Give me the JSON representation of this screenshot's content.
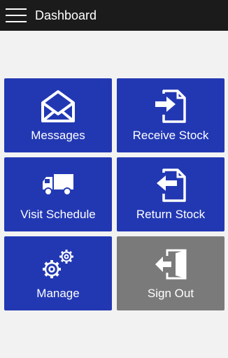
{
  "appbar": {
    "title": "Dashboard",
    "menu_icon": "hamburger-menu-icon"
  },
  "colors": {
    "appbar_bg": "#1b1b1b",
    "tile_blue": "#2238b3",
    "tile_gray": "#7a7a7a",
    "page_bg": "#f2f2f2"
  },
  "tiles": [
    {
      "label": "Messages",
      "icon": "envelope-open-icon"
    },
    {
      "label": "Receive Stock",
      "icon": "document-arrow-in-icon"
    },
    {
      "label": "Visit Schedule",
      "icon": "delivery-truck-icon"
    },
    {
      "label": "Return Stock",
      "icon": "document-arrow-out-icon"
    },
    {
      "label": "Manage",
      "icon": "gears-icon"
    },
    {
      "label": "Sign Out",
      "icon": "door-exit-icon"
    }
  ]
}
